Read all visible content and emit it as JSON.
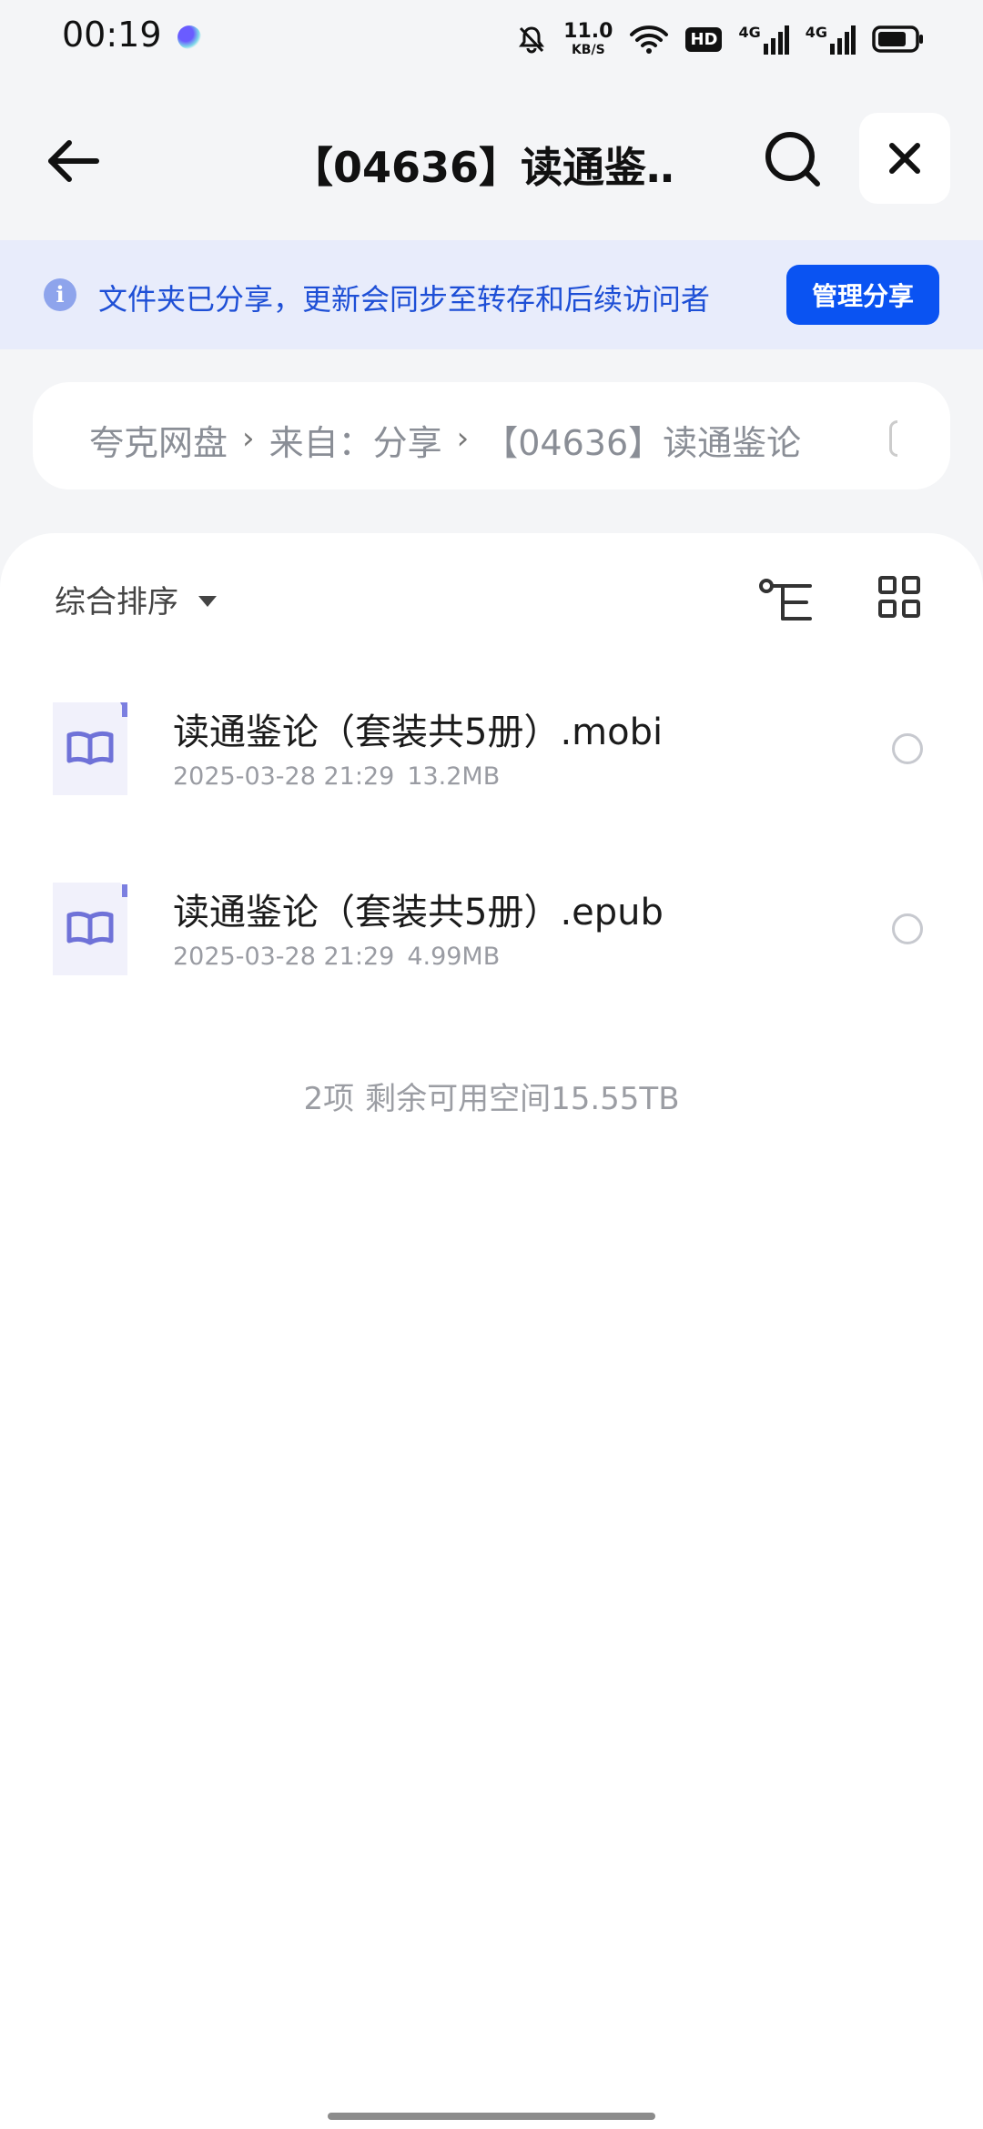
{
  "status_bar": {
    "time": "00:19",
    "net_speed_value": "11.0",
    "net_speed_unit": "KB/S",
    "hd_label": "HD",
    "network_labels": [
      "4G",
      "4G"
    ]
  },
  "appbar": {
    "title": "【04636】读通鉴…"
  },
  "share_banner": {
    "text": "文件夹已分享，更新会同步至转存和后续访问者",
    "button_label": "管理分享"
  },
  "breadcrumb": {
    "items": [
      "夸克网盘",
      "来自：分享",
      "【04636】读通鉴论"
    ],
    "separator": "›"
  },
  "sort": {
    "label": "综合排序"
  },
  "files": [
    {
      "name": "读通鉴论（套装共5册）.mobi",
      "date": "2025-03-28 21:29",
      "size": "13.2MB",
      "icon": "book-icon"
    },
    {
      "name": "读通鉴论（套装共5册）.epub",
      "date": "2025-03-28 21:29",
      "size": "4.99MB",
      "icon": "book-icon"
    }
  ],
  "footer": {
    "count": "2项",
    "space": "剩余可用空间15.55TB"
  },
  "colors": {
    "accent": "#0a53f2",
    "banner_bg": "#e8ecfb",
    "banner_text": "#1e4fd6",
    "file_icon": "#6f72d8"
  }
}
